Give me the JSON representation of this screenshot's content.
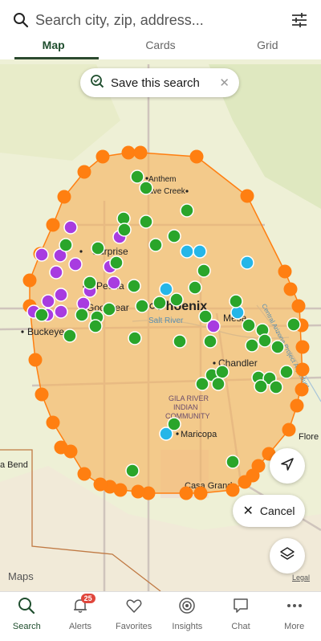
{
  "search": {
    "placeholder": "Search city, zip, address..."
  },
  "tabs": [
    {
      "label": "Map",
      "active": true
    },
    {
      "label": "Cards",
      "active": false
    },
    {
      "label": "Grid",
      "active": false
    }
  ],
  "map": {
    "save_search_label": "Save this search",
    "cancel_label": "Cancel",
    "brand": "Maps",
    "legal": "Legal",
    "place_labels": {
      "anthem": "Anthem",
      "cave_creek": "Cave Creek",
      "surprise": "Surprise",
      "peoria": "Peoria",
      "goodyear": "Goodyear",
      "phoenix": "Phoenix",
      "mesa": "Mesa",
      "buckeye": "Buckeye",
      "salt_river": "Salt River",
      "chandler": "Chandler",
      "gila_river_1": "GILA RIVER",
      "gila_river_2": "INDIAN",
      "gila_river_3": "COMMUNITY",
      "maricopa": "Maricopa",
      "casa_grande": "Casa Grande",
      "florence": "Flore",
      "gila_bend": "a Bend",
      "canal": "Central Arizona Project Aqueduct"
    },
    "colors": {
      "area_fill": "#f6b663",
      "boundary": "#ff7f11",
      "green_pin": "#2aa52a",
      "purple_pin": "#a83ce0",
      "blue_pin": "#25b6e8"
    }
  },
  "nav": [
    {
      "label": "Search",
      "icon": "search-icon",
      "active": true
    },
    {
      "label": "Alerts",
      "icon": "bell-icon",
      "badge": "25"
    },
    {
      "label": "Favorites",
      "icon": "heart-icon"
    },
    {
      "label": "Insights",
      "icon": "insights-icon"
    },
    {
      "label": "Chat",
      "icon": "chat-icon"
    },
    {
      "label": "More",
      "icon": "more-icon"
    }
  ]
}
